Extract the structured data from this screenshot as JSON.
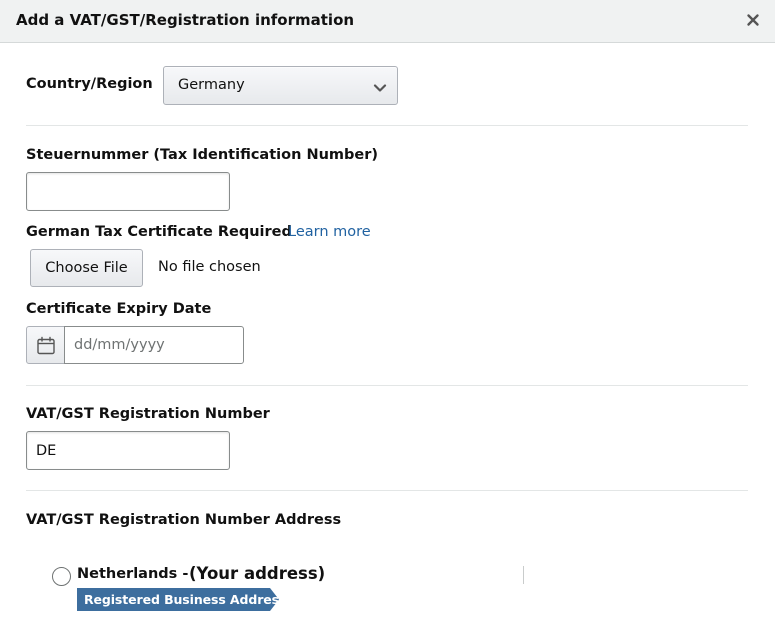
{
  "modal": {
    "title": "Add a VAT/GST/Registration information",
    "close_icon": "close-icon"
  },
  "country": {
    "label": "Country/Region",
    "selected": "Germany",
    "chevron_icon": "chevron-down-icon"
  },
  "tax_id": {
    "label": "Steuernummer (Tax Identification Number)",
    "value": ""
  },
  "certificate": {
    "label": "German Tax Certificate Required",
    "learn_more": "Learn more",
    "button_label": "Choose File",
    "status": "No file chosen"
  },
  "expiry": {
    "label": "Certificate Expiry Date",
    "placeholder": "dd/mm/yyyy",
    "calendar_icon": "calendar-icon"
  },
  "vat": {
    "label": "VAT/GST Registration Number",
    "value": "DE"
  },
  "address": {
    "label": "VAT/GST Registration Number Address",
    "option": {
      "country": "Netherlands -",
      "note": "(Your address)",
      "selected": false,
      "badge": "Registered Business Address",
      "badge_color": "#3d6e9e"
    }
  },
  "colors": {
    "link": "#2162a1",
    "header_bg": "#f0f2f2",
    "text": "#111111"
  }
}
